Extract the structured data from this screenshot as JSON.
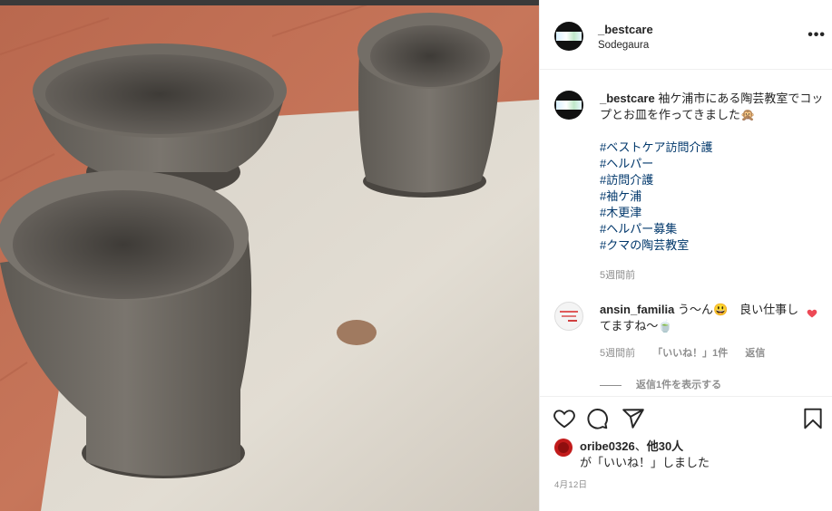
{
  "post": {
    "username": "_bestcare",
    "location": "Sodegaura",
    "caption_text": "袖ケ浦市にある陶芸教室でコップとお皿を作ってきました🙊",
    "hashtags": [
      "#ベストケア訪問介護",
      "#ヘルパー",
      "#訪問介護",
      "#袖ケ浦",
      "#木更津",
      "#ヘルパー募集",
      "#クマの陶芸教室"
    ],
    "caption_time": "5週間前"
  },
  "comment": {
    "username": "ansin_familia",
    "text": "う〜ん😃　良い仕事してますね〜🍵",
    "time": "5週間前",
    "likes": "「いいね！」1件",
    "reply": "返信",
    "view_replies": "返信1件を表示する"
  },
  "likes": {
    "user": "oribe0326",
    "sep": "、",
    "others": "他30人",
    "suffix": "が「いいね！」しました"
  },
  "date": "4月12日",
  "colors": {
    "link": "#00376b",
    "heart": "#ed4956",
    "muted": "#8e8e8e"
  },
  "icons": [
    "more-icon",
    "heart-icon",
    "comment-icon",
    "share-icon",
    "bookmark-icon"
  ]
}
